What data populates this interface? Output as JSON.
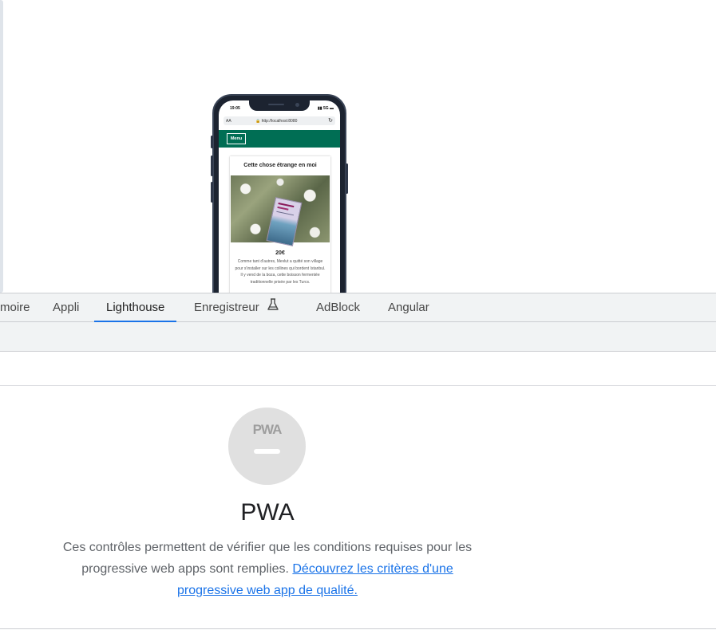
{
  "phone": {
    "status_time": "19:05",
    "status_icons": "5G",
    "url_aa": "AA",
    "url": "http://localhost:8080",
    "menu_label": "Menu",
    "card_title": "Cette chose étrange en moi",
    "price": "20€",
    "description": "Comme tant d'autres, Mevlut a quitté son village pour s'installer sur les collines qui bordent Istanbul. Il y vend de la boza, cette boisson fermentée traditionnelle prisée par les Turcs."
  },
  "tabs": [
    {
      "label": "moire"
    },
    {
      "label": "Appli"
    },
    {
      "label": "Lighthouse",
      "active": true
    },
    {
      "label": "Enregistreur"
    },
    {
      "label": "AdBlock"
    },
    {
      "label": "Angular"
    }
  ],
  "pwa": {
    "logo": "PWA",
    "title": "PWA",
    "description": "Ces contrôles permettent de vérifier que les conditions requises pour les progressive web apps sont remplies.",
    "link": "Découvrez les critères d'une progressive web app de qualité."
  },
  "colors": {
    "accent": "#1a73e8",
    "header_green": "#006e54",
    "gauge_gray": "#e0e0e0"
  }
}
